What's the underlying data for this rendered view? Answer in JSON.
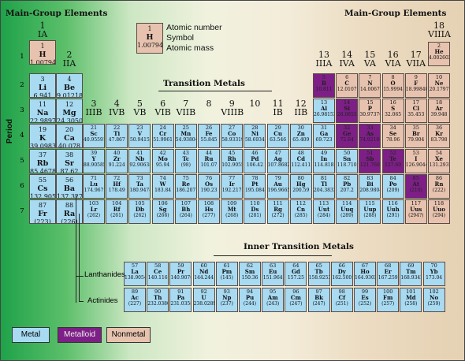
{
  "titles": {
    "main_left": "Main-Group Elements",
    "main_right": "Main-Group Elements",
    "transition": "Transition Metals",
    "inner": "Inner Transition Metals"
  },
  "key": {
    "number": "1",
    "symbol": "H",
    "mass": "1.00794",
    "number_label": "Atomic number",
    "symbol_label": "Symbol",
    "mass_label": "Atomic mass"
  },
  "axis": {
    "period_label": "Period"
  },
  "row_labels": {
    "lanthanides": "Lanthanides",
    "actinides": "Actinides"
  },
  "legend": {
    "metal": "Metal",
    "metalloid": "Metalloid",
    "nonmetal": "Nonmetal"
  },
  "colors": {
    "metal": "#a8daf2",
    "metalloid": "#7d1f86",
    "nonmetal": "#e7c3af"
  },
  "periods": [
    "1",
    "2",
    "3",
    "4",
    "5",
    "6",
    "7"
  ],
  "group_headers": [
    {
      "col": 1,
      "num": "1",
      "roman": "IA"
    },
    {
      "col": 2,
      "num": "2",
      "roman": "IIA"
    },
    {
      "col": 3,
      "num": "3",
      "roman": "IIIB"
    },
    {
      "col": 4,
      "num": "4",
      "roman": "IVB"
    },
    {
      "col": 5,
      "num": "5",
      "roman": "VB"
    },
    {
      "col": 6,
      "num": "6",
      "roman": "VIB"
    },
    {
      "col": 7,
      "num": "7",
      "roman": "VIIB"
    },
    {
      "col": 8,
      "num": "8",
      "roman": ""
    },
    {
      "col": 9,
      "num": "9",
      "roman": "VIIIB"
    },
    {
      "col": 10,
      "num": "10",
      "roman": ""
    },
    {
      "col": 11,
      "num": "11",
      "roman": "IB"
    },
    {
      "col": 12,
      "num": "12",
      "roman": "IIB"
    },
    {
      "col": 13,
      "num": "13",
      "roman": "IIIA"
    },
    {
      "col": 14,
      "num": "14",
      "roman": "IVA"
    },
    {
      "col": 15,
      "num": "15",
      "roman": "VA"
    },
    {
      "col": 16,
      "num": "16",
      "roman": "VIA"
    },
    {
      "col": 17,
      "num": "17",
      "roman": "VIIA"
    },
    {
      "col": 18,
      "num": "18",
      "roman": "VIIIA"
    }
  ],
  "elements": [
    {
      "z": "1",
      "sym": "H",
      "mass": "1.00794",
      "cat": "nonmetal",
      "col": 1,
      "row": 1,
      "big": true
    },
    {
      "z": "2",
      "sym": "He",
      "mass": "4.002602",
      "cat": "nonmetal",
      "col": 18,
      "row": 1
    },
    {
      "z": "3",
      "sym": "Li",
      "mass": "6.941",
      "cat": "metal",
      "col": 1,
      "row": 2,
      "big": true
    },
    {
      "z": "4",
      "sym": "Be",
      "mass": "9.012182",
      "cat": "metal",
      "col": 2,
      "row": 2,
      "big": true
    },
    {
      "z": "5",
      "sym": "B",
      "mass": "10.811",
      "cat": "metalloid",
      "col": 13,
      "row": 2
    },
    {
      "z": "6",
      "sym": "C",
      "mass": "12.0107",
      "cat": "nonmetal",
      "col": 14,
      "row": 2
    },
    {
      "z": "7",
      "sym": "N",
      "mass": "14.0067",
      "cat": "nonmetal",
      "col": 15,
      "row": 2
    },
    {
      "z": "8",
      "sym": "O",
      "mass": "15.9994",
      "cat": "nonmetal",
      "col": 16,
      "row": 2
    },
    {
      "z": "9",
      "sym": "F",
      "mass": "18.9984032",
      "cat": "nonmetal",
      "col": 17,
      "row": 2
    },
    {
      "z": "10",
      "sym": "Ne",
      "mass": "20.1797",
      "cat": "nonmetal",
      "col": 18,
      "row": 2
    },
    {
      "z": "11",
      "sym": "Na",
      "mass": "22.98976928",
      "cat": "metal",
      "col": 1,
      "row": 3,
      "big": true
    },
    {
      "z": "12",
      "sym": "Mg",
      "mass": "24.3050",
      "cat": "metal",
      "col": 2,
      "row": 3,
      "big": true
    },
    {
      "z": "13",
      "sym": "Al",
      "mass": "26.9815386",
      "cat": "metal",
      "col": 13,
      "row": 3
    },
    {
      "z": "14",
      "sym": "Si",
      "mass": "28.0855",
      "cat": "metalloid",
      "col": 14,
      "row": 3
    },
    {
      "z": "15",
      "sym": "P",
      "mass": "30.973762",
      "cat": "nonmetal",
      "col": 15,
      "row": 3
    },
    {
      "z": "16",
      "sym": "S",
      "mass": "32.065",
      "cat": "nonmetal",
      "col": 16,
      "row": 3
    },
    {
      "z": "17",
      "sym": "Cl",
      "mass": "35.453",
      "cat": "nonmetal",
      "col": 17,
      "row": 3
    },
    {
      "z": "18",
      "sym": "Ar",
      "mass": "39.948",
      "cat": "nonmetal",
      "col": 18,
      "row": 3
    },
    {
      "z": "19",
      "sym": "K",
      "mass": "39.0983",
      "cat": "metal",
      "col": 1,
      "row": 4,
      "big": true
    },
    {
      "z": "20",
      "sym": "Ca",
      "mass": "40.078",
      "cat": "metal",
      "col": 2,
      "row": 4,
      "big": true
    },
    {
      "z": "21",
      "sym": "Sc",
      "mass": "40.955912",
      "cat": "metal",
      "col": 3,
      "row": 4
    },
    {
      "z": "22",
      "sym": "Ti",
      "mass": "47.867",
      "cat": "metal",
      "col": 4,
      "row": 4
    },
    {
      "z": "23",
      "sym": "V",
      "mass": "50.9415",
      "cat": "metal",
      "col": 5,
      "row": 4
    },
    {
      "z": "24",
      "sym": "Cr",
      "mass": "51.9961",
      "cat": "metal",
      "col": 6,
      "row": 4
    },
    {
      "z": "25",
      "sym": "Mn",
      "mass": "54.938045",
      "cat": "metal",
      "col": 7,
      "row": 4
    },
    {
      "z": "26",
      "sym": "Fe",
      "mass": "55.845",
      "cat": "metal",
      "col": 8,
      "row": 4
    },
    {
      "z": "27",
      "sym": "Co",
      "mass": "58.933195",
      "cat": "metal",
      "col": 9,
      "row": 4
    },
    {
      "z": "28",
      "sym": "Ni",
      "mass": "58.6934",
      "cat": "metal",
      "col": 10,
      "row": 4
    },
    {
      "z": "29",
      "sym": "Cu",
      "mass": "63.546",
      "cat": "metal",
      "col": 11,
      "row": 4
    },
    {
      "z": "30",
      "sym": "Zn",
      "mass": "65.409",
      "cat": "metal",
      "col": 12,
      "row": 4
    },
    {
      "z": "31",
      "sym": "Ga",
      "mass": "69.723",
      "cat": "metal",
      "col": 13,
      "row": 4
    },
    {
      "z": "32",
      "sym": "Ge",
      "mass": "72.64",
      "cat": "metalloid",
      "col": 14,
      "row": 4
    },
    {
      "z": "33",
      "sym": "As",
      "mass": "74.92160",
      "cat": "metalloid",
      "col": 15,
      "row": 4
    },
    {
      "z": "34",
      "sym": "Se",
      "mass": "78.96",
      "cat": "nonmetal",
      "col": 16,
      "row": 4
    },
    {
      "z": "35",
      "sym": "Br",
      "mass": "79.904",
      "cat": "nonmetal",
      "col": 17,
      "row": 4
    },
    {
      "z": "36",
      "sym": "Kr",
      "mass": "83.798",
      "cat": "nonmetal",
      "col": 18,
      "row": 4
    },
    {
      "z": "37",
      "sym": "Rb",
      "mass": "85.4678",
      "cat": "metal",
      "col": 1,
      "row": 5,
      "big": true
    },
    {
      "z": "38",
      "sym": "Sr",
      "mass": "87.62",
      "cat": "metal",
      "col": 2,
      "row": 5,
      "big": true
    },
    {
      "z": "39",
      "sym": "Y",
      "mass": "88.90585",
      "cat": "metal",
      "col": 3,
      "row": 5
    },
    {
      "z": "40",
      "sym": "Zr",
      "mass": "91.224",
      "cat": "metal",
      "col": 4,
      "row": 5
    },
    {
      "z": "41",
      "sym": "Nb",
      "mass": "92.90638",
      "cat": "metal",
      "col": 5,
      "row": 5
    },
    {
      "z": "42",
      "sym": "Mo",
      "mass": "95.94",
      "cat": "metal",
      "col": 6,
      "row": 5
    },
    {
      "z": "43",
      "sym": "Tc",
      "mass": "(98)",
      "cat": "metal",
      "col": 7,
      "row": 5
    },
    {
      "z": "44",
      "sym": "Ru",
      "mass": "101.07",
      "cat": "metal",
      "col": 8,
      "row": 5
    },
    {
      "z": "45",
      "sym": "Rh",
      "mass": "102.90550",
      "cat": "metal",
      "col": 9,
      "row": 5
    },
    {
      "z": "46",
      "sym": "Pd",
      "mass": "106.42",
      "cat": "metal",
      "col": 10,
      "row": 5
    },
    {
      "z": "47",
      "sym": "Ag",
      "mass": "107.8682",
      "cat": "metal",
      "col": 11,
      "row": 5
    },
    {
      "z": "48",
      "sym": "Cd",
      "mass": "112.411",
      "cat": "metal",
      "col": 12,
      "row": 5
    },
    {
      "z": "49",
      "sym": "In",
      "mass": "114.818",
      "cat": "metal",
      "col": 13,
      "row": 5
    },
    {
      "z": "50",
      "sym": "Sn",
      "mass": "118.710",
      "cat": "metal",
      "col": 14,
      "row": 5
    },
    {
      "z": "51",
      "sym": "Sb",
      "mass": "121.760",
      "cat": "metalloid",
      "col": 15,
      "row": 5
    },
    {
      "z": "52",
      "sym": "Te",
      "mass": "127.60",
      "cat": "metalloid",
      "col": 16,
      "row": 5
    },
    {
      "z": "53",
      "sym": "I",
      "mass": "126.90447",
      "cat": "nonmetal",
      "col": 17,
      "row": 5
    },
    {
      "z": "54",
      "sym": "Xe",
      "mass": "131.293",
      "cat": "nonmetal",
      "col": 18,
      "row": 5
    },
    {
      "z": "55",
      "sym": "Cs",
      "mass": "132.9054519",
      "cat": "metal",
      "col": 1,
      "row": 6,
      "big": true
    },
    {
      "z": "56",
      "sym": "Ba",
      "mass": "137.327",
      "cat": "metal",
      "col": 2,
      "row": 6,
      "big": true
    },
    {
      "z": "71",
      "sym": "Lu",
      "mass": "174.967",
      "cat": "metal",
      "col": 3,
      "row": 6
    },
    {
      "z": "72",
      "sym": "Hf",
      "mass": "178.49",
      "cat": "metal",
      "col": 4,
      "row": 6
    },
    {
      "z": "73",
      "sym": "Ta",
      "mass": "180.94788",
      "cat": "metal",
      "col": 5,
      "row": 6
    },
    {
      "z": "74",
      "sym": "W",
      "mass": "183.84",
      "cat": "metal",
      "col": 6,
      "row": 6
    },
    {
      "z": "75",
      "sym": "Re",
      "mass": "186.207",
      "cat": "metal",
      "col": 7,
      "row": 6
    },
    {
      "z": "76",
      "sym": "Os",
      "mass": "190.23",
      "cat": "metal",
      "col": 8,
      "row": 6
    },
    {
      "z": "77",
      "sym": "Ir",
      "mass": "192.217",
      "cat": "metal",
      "col": 9,
      "row": 6
    },
    {
      "z": "78",
      "sym": "Pt",
      "mass": "195.084",
      "cat": "metal",
      "col": 10,
      "row": 6
    },
    {
      "z": "79",
      "sym": "Au",
      "mass": "196.966569",
      "cat": "metal",
      "col": 11,
      "row": 6
    },
    {
      "z": "80",
      "sym": "Hg",
      "mass": "200.59",
      "cat": "metal",
      "col": 12,
      "row": 6
    },
    {
      "z": "81",
      "sym": "Tl",
      "mass": "204.3833",
      "cat": "metal",
      "col": 13,
      "row": 6
    },
    {
      "z": "82",
      "sym": "Pb",
      "mass": "207.2",
      "cat": "metal",
      "col": 14,
      "row": 6
    },
    {
      "z": "83",
      "sym": "Bi",
      "mass": "208.98040",
      "cat": "metal",
      "col": 15,
      "row": 6
    },
    {
      "z": "84",
      "sym": "Po",
      "mass": "(209)",
      "cat": "metal",
      "col": 16,
      "row": 6
    },
    {
      "z": "85",
      "sym": "At",
      "mass": "(210)",
      "cat": "metalloid",
      "col": 17,
      "row": 6
    },
    {
      "z": "86",
      "sym": "Rn",
      "mass": "(222)",
      "cat": "nonmetal",
      "col": 18,
      "row": 6
    },
    {
      "z": "87",
      "sym": "Fr",
      "mass": "(223)",
      "cat": "metal",
      "col": 1,
      "row": 7,
      "big": true
    },
    {
      "z": "88",
      "sym": "Ra",
      "mass": "(226)",
      "cat": "metal",
      "col": 2,
      "row": 7,
      "big": true
    },
    {
      "z": "103",
      "sym": "Lr",
      "mass": "(262)",
      "cat": "metal",
      "col": 3,
      "row": 7
    },
    {
      "z": "104",
      "sym": "Rf",
      "mass": "(261)",
      "cat": "metal",
      "col": 4,
      "row": 7
    },
    {
      "z": "105",
      "sym": "Db",
      "mass": "(262)",
      "cat": "metal",
      "col": 5,
      "row": 7
    },
    {
      "z": "106",
      "sym": "Sg",
      "mass": "(266)",
      "cat": "metal",
      "col": 6,
      "row": 7
    },
    {
      "z": "107",
      "sym": "Bh",
      "mass": "(264)",
      "cat": "metal",
      "col": 7,
      "row": 7
    },
    {
      "z": "108",
      "sym": "Hs",
      "mass": "(277)",
      "cat": "metal",
      "col": 8,
      "row": 7
    },
    {
      "z": "109",
      "sym": "Mt",
      "mass": "(268)",
      "cat": "metal",
      "col": 9,
      "row": 7
    },
    {
      "z": "110",
      "sym": "Ds",
      "mass": "(281)",
      "cat": "metal",
      "col": 10,
      "row": 7
    },
    {
      "z": "111",
      "sym": "Rg",
      "mass": "(272)",
      "cat": "metal",
      "col": 11,
      "row": 7
    },
    {
      "z": "112",
      "sym": "Cn",
      "mass": "(285)",
      "cat": "metal",
      "col": 12,
      "row": 7
    },
    {
      "z": "113",
      "sym": "Uut",
      "mass": "(284)",
      "cat": "metal",
      "col": 13,
      "row": 7
    },
    {
      "z": "114",
      "sym": "Uuq",
      "mass": "(289)",
      "cat": "metal",
      "col": 14,
      "row": 7
    },
    {
      "z": "115",
      "sym": "Uup",
      "mass": "(288)",
      "cat": "metal",
      "col": 15,
      "row": 7
    },
    {
      "z": "116",
      "sym": "Uuh",
      "mass": "(291)",
      "cat": "metal",
      "col": 16,
      "row": 7
    },
    {
      "z": "117",
      "sym": "Uus",
      "mass": "(294?)",
      "cat": "nonmetal",
      "col": 17,
      "row": 7
    },
    {
      "z": "118",
      "sym": "Uuo",
      "mass": "(294)",
      "cat": "nonmetal",
      "col": 18,
      "row": 7
    }
  ],
  "lanthanides": [
    {
      "z": "57",
      "sym": "La",
      "mass": "138.90547"
    },
    {
      "z": "58",
      "sym": "Ce",
      "mass": "140.116"
    },
    {
      "z": "59",
      "sym": "Pr",
      "mass": "140.90765"
    },
    {
      "z": "60",
      "sym": "Nd",
      "mass": "144.244"
    },
    {
      "z": "61",
      "sym": "Pm",
      "mass": "(145)"
    },
    {
      "z": "62",
      "sym": "Sm",
      "mass": "150.36"
    },
    {
      "z": "63",
      "sym": "Eu",
      "mass": "151.964"
    },
    {
      "z": "64",
      "sym": "Gd",
      "mass": "157.25"
    },
    {
      "z": "65",
      "sym": "Tb",
      "mass": "158.92535"
    },
    {
      "z": "66",
      "sym": "Dy",
      "mass": "162.500"
    },
    {
      "z": "67",
      "sym": "Ho",
      "mass": "164.93032"
    },
    {
      "z": "68",
      "sym": "Er",
      "mass": "167.259"
    },
    {
      "z": "69",
      "sym": "Tm",
      "mass": "168.93421"
    },
    {
      "z": "70",
      "sym": "Yb",
      "mass": "173.04"
    }
  ],
  "actinides": [
    {
      "z": "89",
      "sym": "Ac",
      "mass": "(227)"
    },
    {
      "z": "90",
      "sym": "Th",
      "mass": "232.03806"
    },
    {
      "z": "91",
      "sym": "Pa",
      "mass": "231.03588"
    },
    {
      "z": "92",
      "sym": "U",
      "mass": "238.02891"
    },
    {
      "z": "93",
      "sym": "Np",
      "mass": "(237)"
    },
    {
      "z": "94",
      "sym": "Pu",
      "mass": "(244)"
    },
    {
      "z": "95",
      "sym": "Am",
      "mass": "(243)"
    },
    {
      "z": "96",
      "sym": "Cm",
      "mass": "(247)"
    },
    {
      "z": "97",
      "sym": "Bk",
      "mass": "(247)"
    },
    {
      "z": "98",
      "sym": "Cf",
      "mass": "(251)"
    },
    {
      "z": "99",
      "sym": "Es",
      "mass": "(252)"
    },
    {
      "z": "100",
      "sym": "Fm",
      "mass": "(257)"
    },
    {
      "z": "101",
      "sym": "Md",
      "mass": "(258)"
    },
    {
      "z": "102",
      "sym": "No",
      "mass": "(259)"
    }
  ]
}
